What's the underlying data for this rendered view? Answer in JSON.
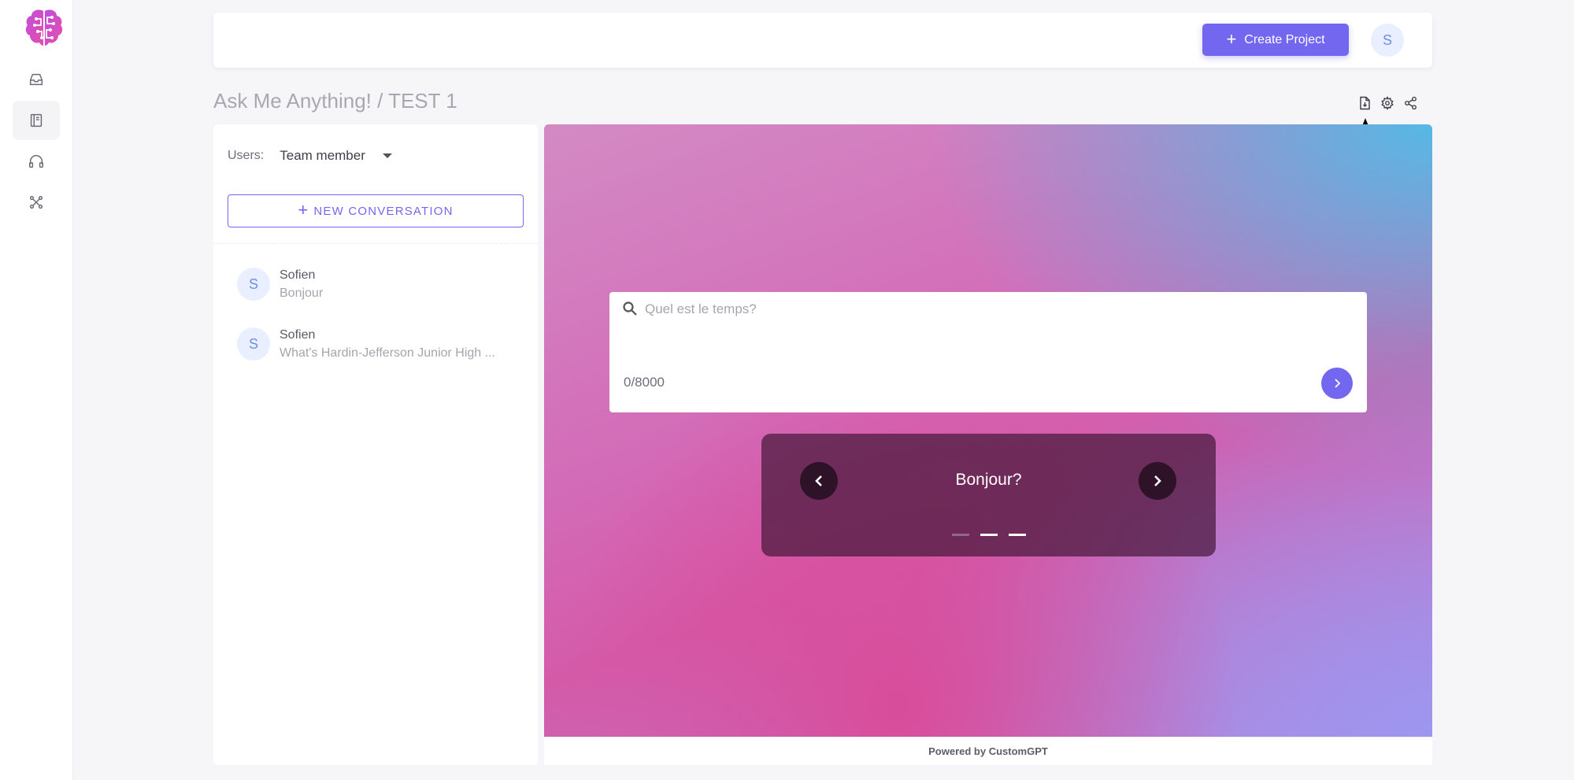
{
  "rail": {
    "items": [
      {
        "icon": "inbox-icon"
      },
      {
        "icon": "book-icon",
        "active": true
      },
      {
        "icon": "headphones-icon"
      },
      {
        "icon": "network-icon"
      }
    ]
  },
  "header": {
    "create_label": "Create Project",
    "avatar_letter": "S"
  },
  "breadcrumb": "Ask Me Anything! / TEST 1",
  "panel": {
    "users_label": "Users:",
    "users_value": "Team member",
    "new_conversation_label": "NEW CONVERSATION",
    "conversations": [
      {
        "avatar": "S",
        "name": "Sofien",
        "message": "Bonjour"
      },
      {
        "avatar": "S",
        "name": "Sofien",
        "message": "What's Hardin-Jefferson Junior High ..."
      }
    ]
  },
  "chat": {
    "placeholder": "Quel est le temps?",
    "counter": "0/8000",
    "carousel_text": "Bonjour?",
    "footer": "Powered by CustomGPT"
  },
  "colors": {
    "accent": "#7367f0",
    "avatar_bg": "#e9efff"
  }
}
